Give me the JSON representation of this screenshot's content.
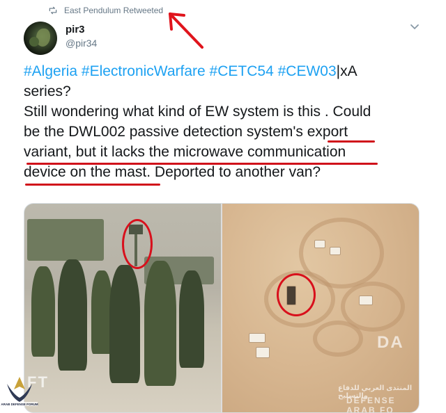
{
  "retweet": {
    "label": "East Pendulum Retweeted"
  },
  "author": {
    "display_name": "pir3",
    "handle": "@pir34"
  },
  "tweet": {
    "lines": [
      {
        "parts": [
          {
            "text": "#Algeria",
            "hashtag": true
          },
          {
            "text": " ",
            "hashtag": false
          },
          {
            "text": "#ElectronicWarfare",
            "hashtag": true
          },
          {
            "text": " ",
            "hashtag": false
          },
          {
            "text": "#CETC54",
            "hashtag": true
          },
          {
            "text": " ",
            "hashtag": false
          },
          {
            "text": "#CEW03",
            "hashtag": true
          },
          {
            "text": "|xA",
            "hashtag": false
          }
        ]
      },
      {
        "parts": [
          {
            "text": "series?",
            "hashtag": false
          }
        ]
      },
      {
        "parts": [
          {
            "text": "Still wondering what kind of EW system is this . Could",
            "hashtag": false
          }
        ]
      },
      {
        "parts": [
          {
            "text": "be the DWL002 passive detection system's export",
            "hashtag": false
          }
        ]
      },
      {
        "parts": [
          {
            "text": "variant, but it lacks the microwave communication",
            "hashtag": false
          }
        ]
      },
      {
        "parts": [
          {
            "text": "device on the mast. Deported to another van?",
            "hashtag": false
          }
        ]
      }
    ]
  },
  "media": {
    "left_watermark": "FT",
    "right_watermark_top": "DA",
    "right_watermark_bottom": "DEFENSE ARAB FO",
    "right_watermark_arabic": "المنتدى العربي للدفاع والتسليح"
  },
  "logo": {
    "text": "ARAB DEFENSE FORUM"
  },
  "colors": {
    "hashtag": "#1da1f2",
    "annotation": "#d8101c",
    "muted": "#657786"
  },
  "icons": {
    "retweet": "retweet-icon",
    "caret": "chevron-down-icon"
  }
}
